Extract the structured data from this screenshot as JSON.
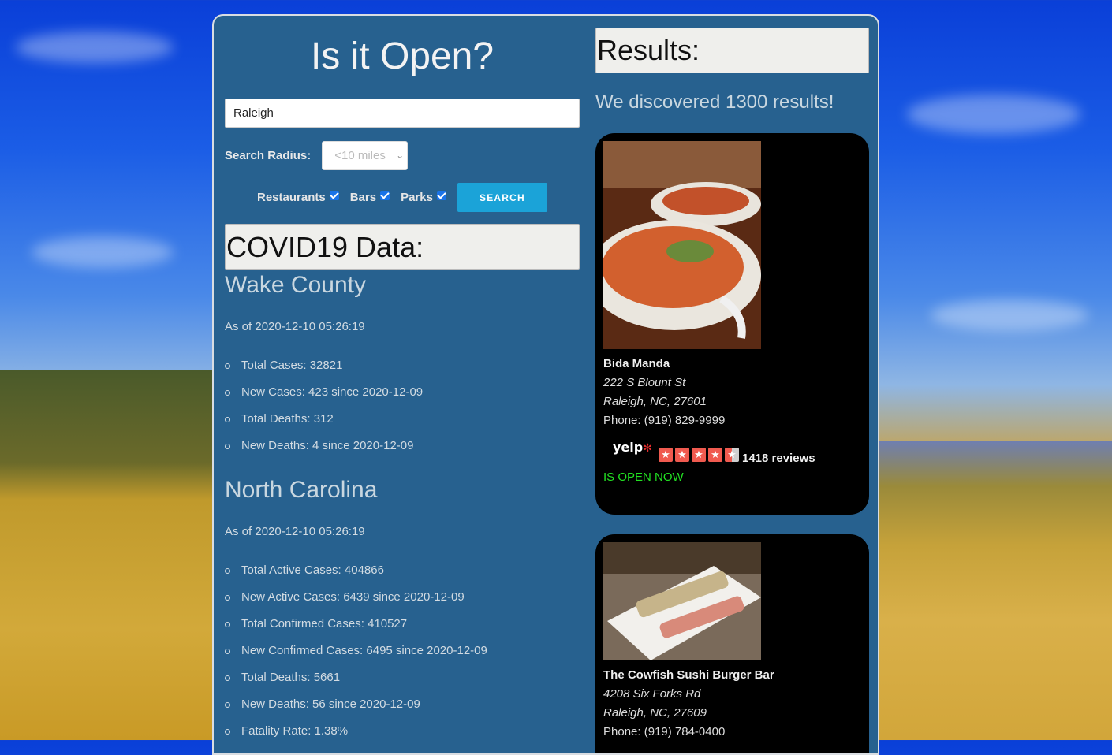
{
  "app": {
    "title": "Is it Open?"
  },
  "search": {
    "value": "Raleigh",
    "placeholder": ""
  },
  "radius": {
    "label": "Search Radius:",
    "selected": "<10 miles"
  },
  "filters": [
    {
      "label": "Restaurants",
      "checked": true
    },
    {
      "label": "Bars",
      "checked": true
    },
    {
      "label": "Parks",
      "checked": true
    }
  ],
  "search_button": {
    "label": "SEARCH"
  },
  "covid": {
    "heading": "COVID19 Data:",
    "county": {
      "title": "Wake County",
      "as_of": "As of 2020-12-10 05:26:19",
      "stats": [
        "Total Cases: 32821",
        "New Cases: 423 since 2020-12-09",
        "Total Deaths: 312",
        "New Deaths: 4 since 2020-12-09"
      ]
    },
    "state": {
      "title": "North Carolina",
      "as_of": "As of 2020-12-10 05:26:19",
      "stats": [
        "Total Active Cases: 404866",
        "New Active Cases: 6439 since 2020-12-09",
        "Total Confirmed Cases: 410527",
        "New Confirmed Cases: 6495 since 2020-12-09",
        "Total Deaths: 5661",
        "New Deaths: 56 since 2020-12-09",
        "Fatality Rate: 1.38%"
      ]
    }
  },
  "results": {
    "heading": "Results:",
    "summary": "We discovered 1300 results!",
    "items": [
      {
        "name": "Bida Manda",
        "street": "222 S Blount St",
        "city": "Raleigh, NC, 27601",
        "phone": "Phone: (919) 829-9999",
        "rating": 4.5,
        "reviews": "1418 reviews",
        "status": "IS OPEN NOW",
        "yelp": "yelp"
      },
      {
        "name": "The Cowfish Sushi Burger Bar",
        "street": "4208 Six Forks Rd",
        "city": "Raleigh, NC, 27609",
        "phone": "Phone: (919) 784-0400"
      }
    ]
  },
  "colors": {
    "panel": "#27618f",
    "button": "#1ba3d8",
    "open": "#22e022"
  }
}
